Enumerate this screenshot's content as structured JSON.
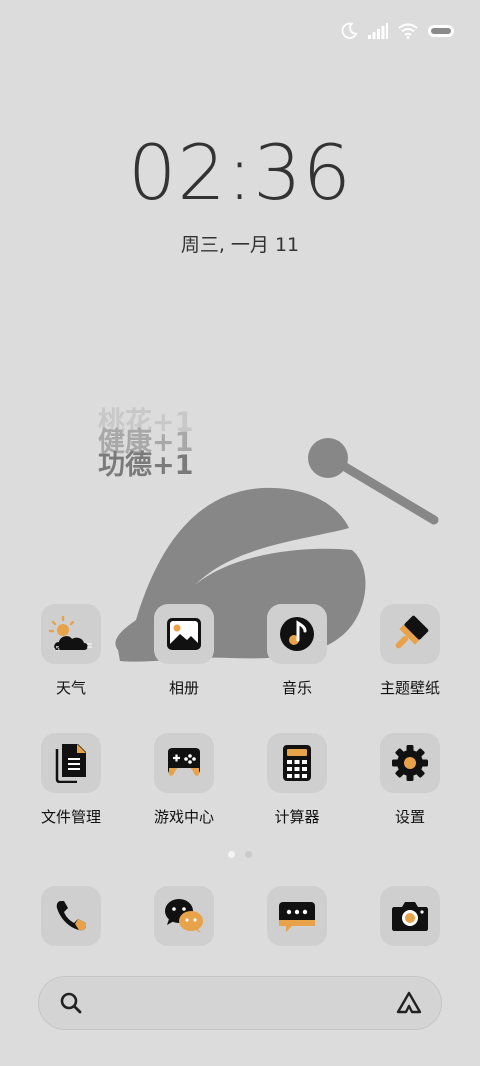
{
  "status_bar": {
    "icons": [
      "moon-icon",
      "signal-icon",
      "wifi-icon",
      "battery-icon"
    ]
  },
  "lock": {
    "time": "02:36",
    "date": "周三, 一月 11"
  },
  "widget": {
    "merit_lines": [
      "桃花+1",
      "健康+1",
      "功德+1"
    ]
  },
  "apps_row1": [
    {
      "label": "天气",
      "icon": "weather-icon"
    },
    {
      "label": "相册",
      "icon": "gallery-icon"
    },
    {
      "label": "音乐",
      "icon": "music-icon"
    },
    {
      "label": "主题壁纸",
      "icon": "theme-brush-icon"
    }
  ],
  "apps_row2": [
    {
      "label": "文件管理",
      "icon": "files-icon"
    },
    {
      "label": "游戏中心",
      "icon": "gamepad-icon"
    },
    {
      "label": "计算器",
      "icon": "calculator-icon"
    },
    {
      "label": "设置",
      "icon": "settings-gear-icon"
    }
  ],
  "pager": {
    "pages": 2,
    "current": 1
  },
  "dock": [
    {
      "icon": "phone-icon"
    },
    {
      "icon": "wechat-icon"
    },
    {
      "icon": "messages-icon"
    },
    {
      "icon": "camera-icon"
    }
  ],
  "colors": {
    "background": "#dcdcdc",
    "icon_tile": "#cfcfcf",
    "accent": "#e8a24a",
    "glyph": "#111111",
    "muyu": "#878787"
  }
}
